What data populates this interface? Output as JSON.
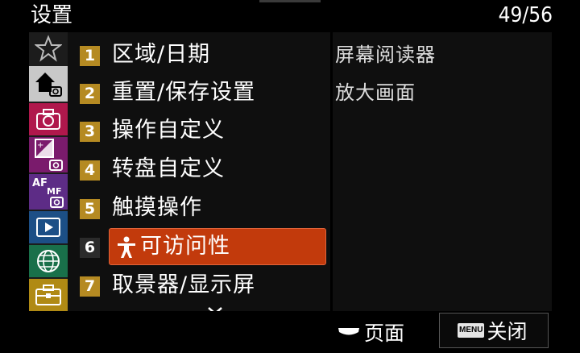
{
  "header": {
    "title": "设置",
    "page_indicator": "49/56"
  },
  "sidebar": {
    "items": [
      {
        "icon": "star-icon",
        "color": "#1c1c1c"
      },
      {
        "icon": "home-camera-icon",
        "color": "#c8c8c8",
        "selected": true
      },
      {
        "icon": "camera-icon",
        "color": "#b0184c"
      },
      {
        "icon": "exposure-camera-icon",
        "color": "#7a1b6c"
      },
      {
        "icon": "af-mf-camera-icon",
        "color": "#5d2c86"
      },
      {
        "icon": "playback-icon",
        "color": "#1c4f86"
      },
      {
        "icon": "globe-icon",
        "color": "#19704a"
      },
      {
        "icon": "toolbox-icon",
        "color": "#b08a14"
      }
    ]
  },
  "menu": {
    "items": [
      {
        "num": "1",
        "label": "区域/日期"
      },
      {
        "num": "2",
        "label": "重置/保存设置"
      },
      {
        "num": "3",
        "label": "操作自定义"
      },
      {
        "num": "4",
        "label": "转盘自定义"
      },
      {
        "num": "5",
        "label": "触摸操作"
      },
      {
        "num": "6",
        "label": "可访问性",
        "selected": true
      },
      {
        "num": "7",
        "label": "取景器/显示屏"
      }
    ]
  },
  "submenu": {
    "items": [
      "屏幕阅读器",
      "放大画面"
    ]
  },
  "footer": {
    "page_label": "页面",
    "menu_key": "MENU",
    "close_label": "关闭"
  }
}
